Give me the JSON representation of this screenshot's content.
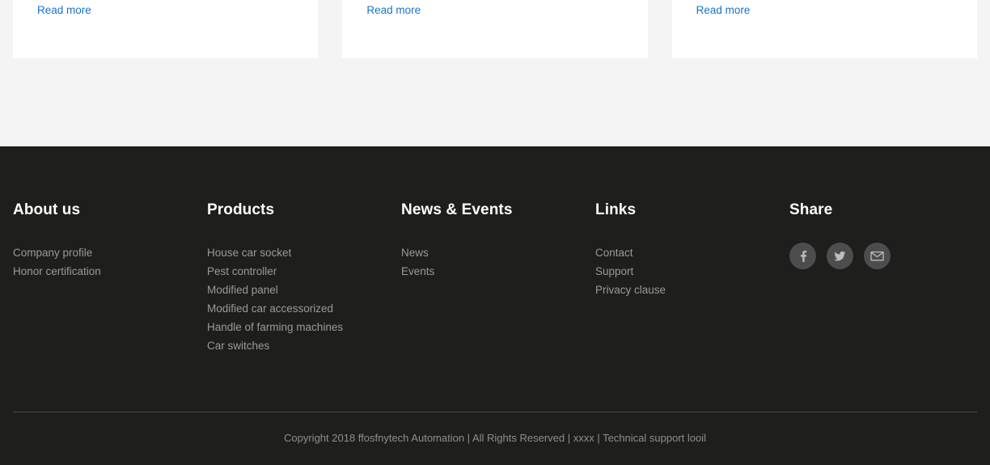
{
  "cards": [
    {
      "read_more_label": "Read more"
    },
    {
      "read_more_label": "Read more"
    },
    {
      "read_more_label": "Read more"
    }
  ],
  "footer": {
    "background_color": "#1e1e1c",
    "heading_color": "#ffffff",
    "link_color": "#9a9a9a",
    "link_accent_color": "#1a73c7",
    "columns": [
      {
        "title": "About us",
        "items": [
          {
            "label": "Company profile"
          },
          {
            "label": "Honor certification"
          }
        ]
      },
      {
        "title": "Products",
        "items": [
          {
            "label": "House car socket"
          },
          {
            "label": "Pest controller"
          },
          {
            "label": "Modified panel"
          },
          {
            "label": "Modified car accessorized"
          },
          {
            "label": "Handle of farming machines"
          },
          {
            "label": "Car switches"
          }
        ]
      },
      {
        "title": "News & Events",
        "items": [
          {
            "label": "News"
          },
          {
            "label": "Events"
          }
        ]
      },
      {
        "title": "Links",
        "items": [
          {
            "label": "Contact"
          },
          {
            "label": "Support"
          },
          {
            "label": "Privacy clause"
          }
        ]
      }
    ],
    "share": {
      "title": "Share",
      "buttons": [
        {
          "icon": "facebook-icon",
          "label": "Facebook"
        },
        {
          "icon": "twitter-icon",
          "label": "Twitter"
        },
        {
          "icon": "email-icon",
          "label": "Email"
        }
      ],
      "button_background": "#4d4d4d",
      "icon_color": "#bdbdbd"
    },
    "copyright": "Copyright 2018 ffosfnytech Automation | All Rights Reserved | xxxx | Technical support looil"
  }
}
